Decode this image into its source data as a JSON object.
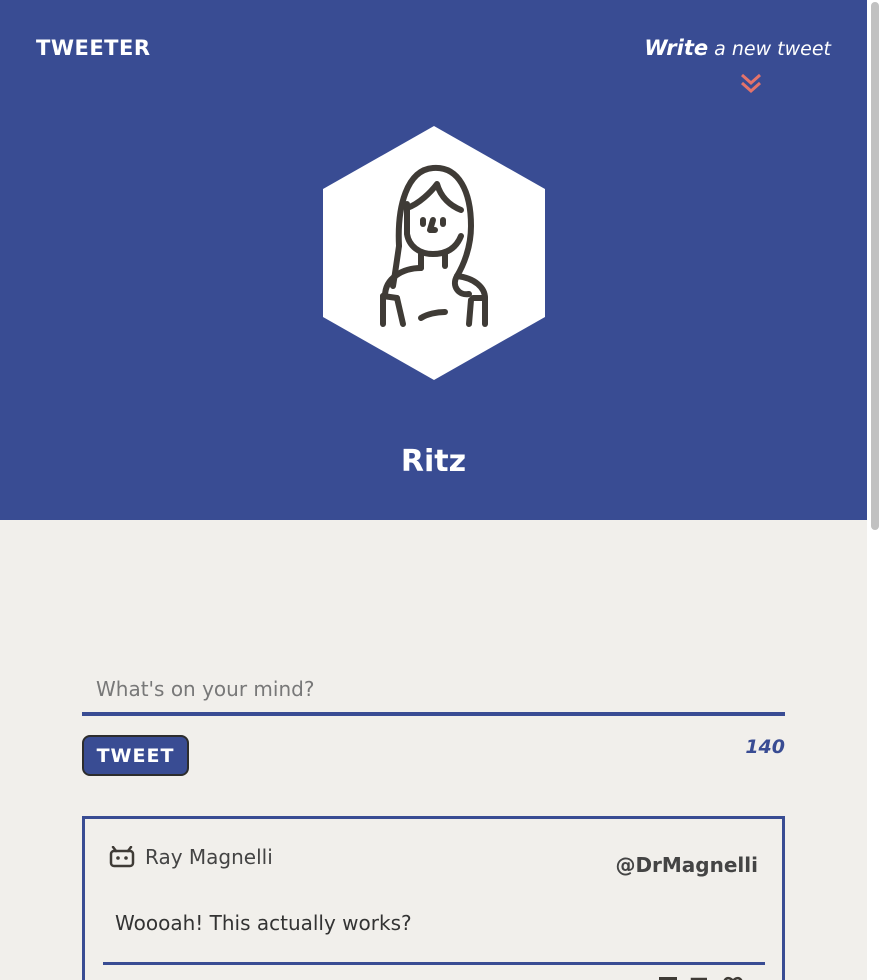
{
  "header": {
    "logo": "TWEETER",
    "write_strong": "Write",
    "write_rest": " a new tweet",
    "username": "Ritz",
    "background_color": "#394c93",
    "accent_color": "#e5736a"
  },
  "compose": {
    "placeholder": "What's on your mind?",
    "button_label": "TWEET",
    "char_count": "140"
  },
  "tweets": [
    {
      "author_name": "Ray Magnelli",
      "handle": "@DrMagnelli",
      "content": "Woooah! This actually works?",
      "author_icon": "robot-icon",
      "action_icons": [
        "flag-icon",
        "retweet-icon",
        "heart-icon"
      ]
    }
  ]
}
